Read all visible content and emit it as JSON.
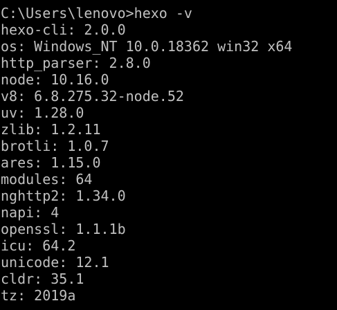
{
  "colors": {
    "background": "#000000",
    "foreground": "#c0c0c0"
  },
  "prompt": {
    "path": "C:\\Users\\lenovo>",
    "command": "hexo -v"
  },
  "output": [
    "hexo-cli: 2.0.0",
    "os: Windows_NT 10.0.18362 win32 x64",
    "http_parser: 2.8.0",
    "node: 10.16.0",
    "v8: 6.8.275.32-node.52",
    "uv: 1.28.0",
    "zlib: 1.2.11",
    "brotli: 1.0.7",
    "ares: 1.15.0",
    "modules: 64",
    "nghttp2: 1.34.0",
    "napi: 4",
    "openssl: 1.1.1b",
    "icu: 64.2",
    "unicode: 12.1",
    "cldr: 35.1",
    "tz: 2019a"
  ]
}
